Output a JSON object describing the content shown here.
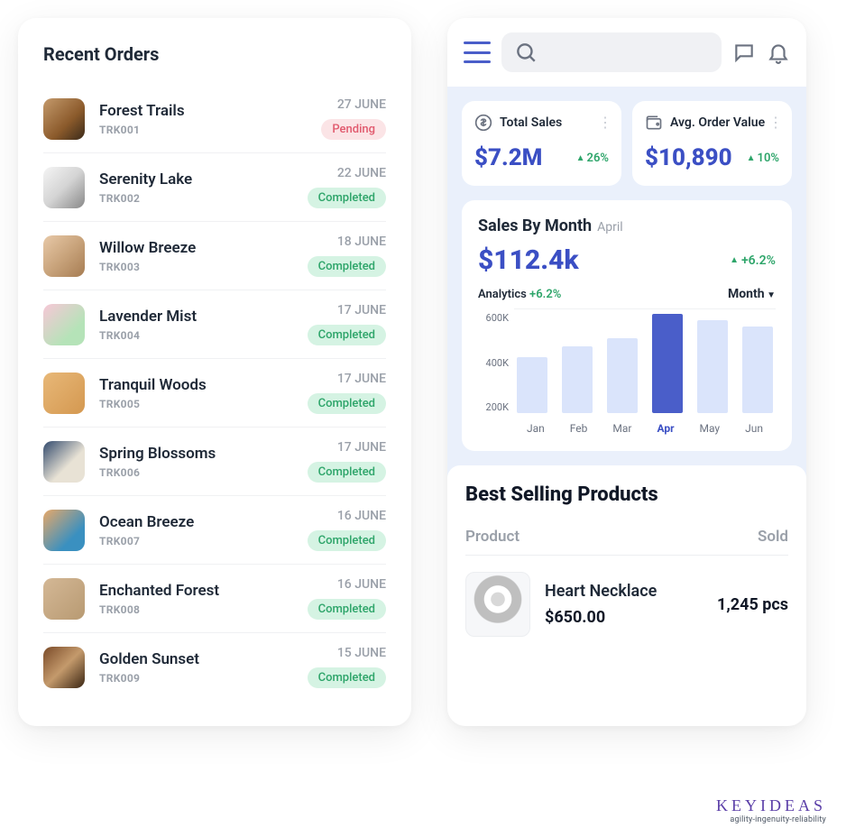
{
  "recent_orders": {
    "title": "Recent Orders",
    "items": [
      {
        "name": "Forest Trails",
        "code": "TRK001",
        "date": "27 JUNE",
        "status": "Pending",
        "status_class": "pending"
      },
      {
        "name": "Serenity Lake",
        "code": "TRK002",
        "date": "22 JUNE",
        "status": "Completed",
        "status_class": "completed"
      },
      {
        "name": "Willow Breeze",
        "code": "TRK003",
        "date": "18 JUNE",
        "status": "Completed",
        "status_class": "completed"
      },
      {
        "name": "Lavender Mist",
        "code": "TRK004",
        "date": "17 JUNE",
        "status": "Completed",
        "status_class": "completed"
      },
      {
        "name": "Tranquil Woods",
        "code": "TRK005",
        "date": "17 JUNE",
        "status": "Completed",
        "status_class": "completed"
      },
      {
        "name": "Spring Blossoms",
        "code": "TRK006",
        "date": "17 JUNE",
        "status": "Completed",
        "status_class": "completed"
      },
      {
        "name": "Ocean Breeze",
        "code": "TRK007",
        "date": "16 JUNE",
        "status": "Completed",
        "status_class": "completed"
      },
      {
        "name": "Enchanted Forest",
        "code": "TRK008",
        "date": "16 JUNE",
        "status": "Completed",
        "status_class": "completed"
      },
      {
        "name": "Golden Sunset",
        "code": "TRK009",
        "date": "15 JUNE",
        "status": "Completed",
        "status_class": "completed"
      }
    ]
  },
  "stats": {
    "total_sales": {
      "label": "Total Sales",
      "value": "$7.2M",
      "delta": "26%"
    },
    "avg_order_value": {
      "label": "Avg. Order Value",
      "value": "$10,890",
      "delta": "10%"
    }
  },
  "sales_by_month": {
    "title": "Sales By Month",
    "month": "April",
    "value": "$112.4k",
    "delta": "+6.2%",
    "analytics_label": "Analytics",
    "analytics_pct": "+6.2%",
    "period": "Month"
  },
  "best_selling": {
    "title": "Best Selling Products",
    "col_product": "Product",
    "col_sold": "Sold",
    "items": [
      {
        "name": "Heart Necklace",
        "price": "$650.00",
        "sold": "1,245 pcs"
      }
    ]
  },
  "branding": {
    "name": "KEYIDEAS",
    "tagline": "agility-ingenuity-reliability"
  },
  "chart_data": {
    "type": "bar",
    "title": "Sales By Month",
    "xlabel": "",
    "ylabel": "",
    "categories": [
      "Jan",
      "Feb",
      "Mar",
      "Apr",
      "May",
      "Jun"
    ],
    "values": [
      350000,
      420000,
      470000,
      620000,
      580000,
      540000
    ],
    "y_ticks": [
      "600K",
      "400K",
      "200K"
    ],
    "ylim": [
      0,
      650000
    ],
    "highlight_index": 3
  }
}
